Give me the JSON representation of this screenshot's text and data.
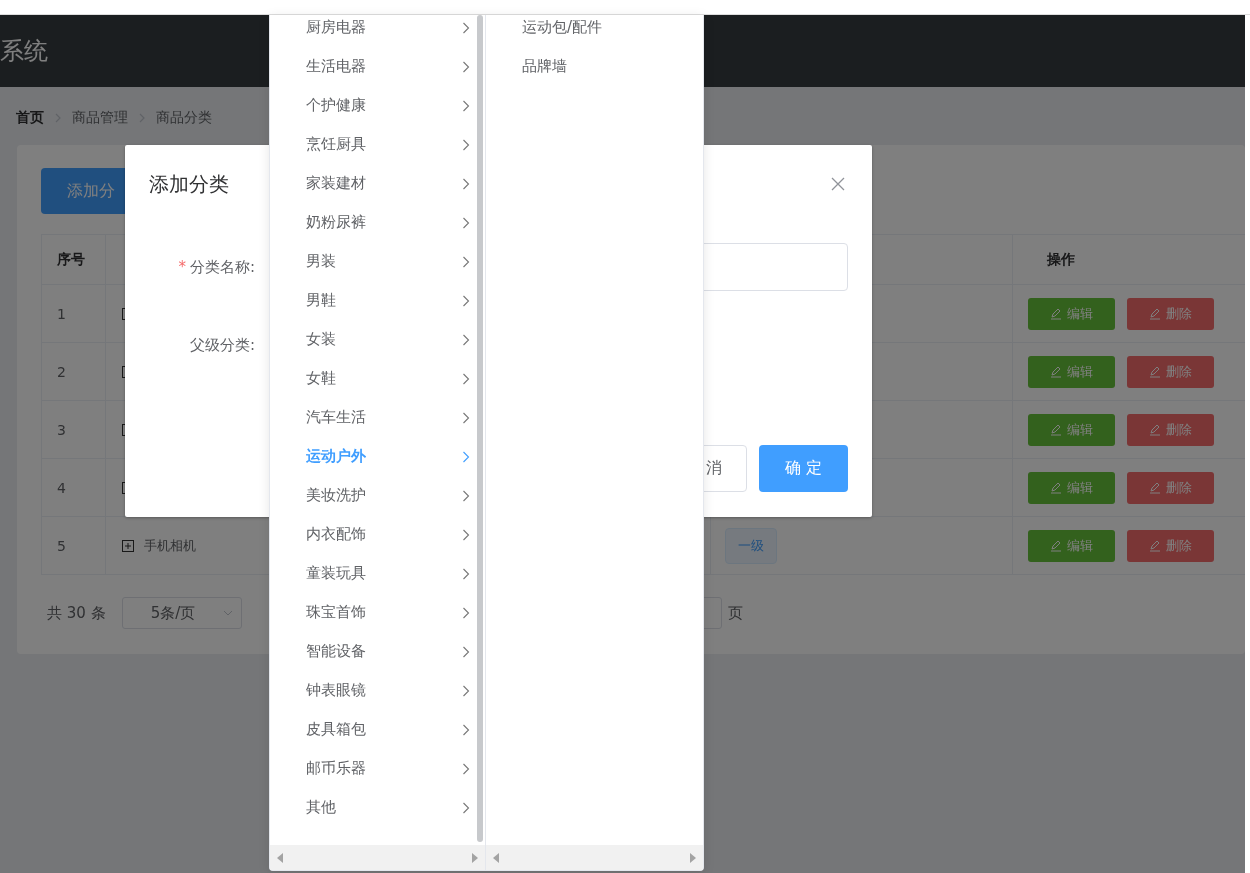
{
  "header": {
    "title": "系统"
  },
  "breadcrumb": [
    {
      "label": "首页"
    },
    {
      "label": "商品管理"
    },
    {
      "label": "商品分类"
    }
  ],
  "add_button": {
    "label": "添加分"
  },
  "table": {
    "columns": {
      "index": "序号",
      "actions": "操作"
    },
    "rows": [
      {
        "index": "1",
        "edit": "编辑",
        "delete": "删除"
      },
      {
        "index": "2",
        "edit": "编辑",
        "delete": "删除"
      },
      {
        "index": "3",
        "edit": "编辑",
        "delete": "删除"
      },
      {
        "index": "4",
        "edit": "编辑",
        "delete": "删除"
      },
      {
        "index": "5",
        "name": "手机相机",
        "level_tag": "一级",
        "edit": "编辑",
        "delete": "删除"
      }
    ]
  },
  "pagination": {
    "total": "共 30 条",
    "page_size": "5条/页",
    "suffix": "页"
  },
  "dialog": {
    "title": "添加分类",
    "fields": [
      {
        "label": "分类名称:",
        "required_mark": "*",
        "kind": "input"
      },
      {
        "label": "父级分类:",
        "kind": "cascader"
      }
    ],
    "buttons": [
      {
        "label": "消",
        "kind": "default"
      },
      {
        "label": "确 定",
        "kind": "primary"
      }
    ]
  },
  "cascader": {
    "columns": [
      {
        "items": [
          {
            "label": "厨房电器",
            "selected": false,
            "has_children": true
          },
          {
            "label": "生活电器",
            "selected": false,
            "has_children": true
          },
          {
            "label": "个护健康",
            "selected": false,
            "has_children": true
          },
          {
            "label": "烹饪厨具",
            "selected": false,
            "has_children": true
          },
          {
            "label": "家装建材",
            "selected": false,
            "has_children": true
          },
          {
            "label": "奶粉尿裤",
            "selected": false,
            "has_children": true
          },
          {
            "label": "男装",
            "selected": false,
            "has_children": true
          },
          {
            "label": "男鞋",
            "selected": false,
            "has_children": true
          },
          {
            "label": "女装",
            "selected": false,
            "has_children": true
          },
          {
            "label": "女鞋",
            "selected": false,
            "has_children": true
          },
          {
            "label": "汽车生活",
            "selected": false,
            "has_children": true
          },
          {
            "label": "运动户外",
            "selected": true,
            "has_children": true
          },
          {
            "label": "美妆洗护",
            "selected": false,
            "has_children": true
          },
          {
            "label": "内衣配饰",
            "selected": false,
            "has_children": true
          },
          {
            "label": "童装玩具",
            "selected": false,
            "has_children": true
          },
          {
            "label": "珠宝首饰",
            "selected": false,
            "has_children": true
          },
          {
            "label": "智能设备",
            "selected": false,
            "has_children": true
          },
          {
            "label": "钟表眼镜",
            "selected": false,
            "has_children": true
          },
          {
            "label": "皮具箱包",
            "selected": false,
            "has_children": true
          },
          {
            "label": "邮币乐器",
            "selected": false,
            "has_children": true
          },
          {
            "label": "其他",
            "selected": false,
            "has_children": true
          }
        ]
      },
      {
        "items": [
          {
            "label": "运动包/配件",
            "selected": false,
            "has_children": false
          },
          {
            "label": "品牌墙",
            "selected": false,
            "has_children": false
          }
        ]
      }
    ]
  }
}
